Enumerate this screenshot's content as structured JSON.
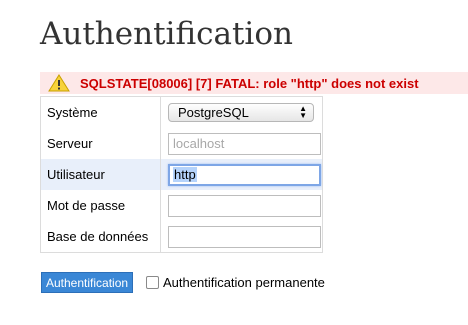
{
  "page": {
    "title": "Authentification"
  },
  "error": {
    "icon": "warning-icon",
    "message": "SQLSTATE[08006] [7] FATAL: role \"http\" does not exist"
  },
  "form": {
    "rows": [
      {
        "label": "Système",
        "value": "PostgreSQL"
      },
      {
        "label": "Serveur",
        "placeholder": "localhost",
        "value": ""
      },
      {
        "label": "Utilisateur",
        "value": "http"
      },
      {
        "label": "Mot de passe",
        "value": ""
      },
      {
        "label": "Base de données",
        "value": ""
      }
    ]
  },
  "actions": {
    "submit_label": "Authentification",
    "permanent_label": "Authentification permanente"
  },
  "colors": {
    "error_text": "#cc0000",
    "error_bg": "#fde8e8",
    "button_bg": "#3a87d6",
    "focus_ring": "#7ea6e6"
  }
}
